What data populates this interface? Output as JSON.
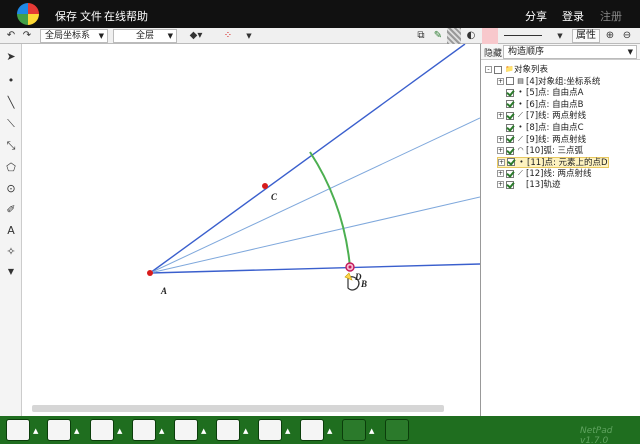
{
  "menubar": {
    "items": [
      "保存",
      "文件",
      "在线帮助"
    ],
    "right": {
      "share": "分享",
      "login": "登录",
      "register": "注册"
    }
  },
  "toolbar": {
    "coord_system": "全局坐标系",
    "layer": "全层",
    "properties": "属性"
  },
  "right_panel": {
    "hide_label": "隐藏",
    "order": "构造顺序",
    "tree": [
      {
        "label": "对象列表",
        "level": 0,
        "expander": "-",
        "check": "none",
        "icon": "folder"
      },
      {
        "label": "[4]对象组:坐标系统",
        "level": 1,
        "expander": "+",
        "check": "off",
        "icon": "group"
      },
      {
        "label": "[5]点: 自由点A",
        "level": 1,
        "expander": "",
        "check": "on",
        "icon": "point"
      },
      {
        "label": "[6]点: 自由点B",
        "level": 1,
        "expander": "",
        "check": "on",
        "icon": "point"
      },
      {
        "label": "[7]线: 两点射线",
        "level": 1,
        "expander": "+",
        "check": "on",
        "icon": "ray"
      },
      {
        "label": "[8]点: 自由点C",
        "level": 1,
        "expander": "",
        "check": "on",
        "icon": "point"
      },
      {
        "label": "[9]线: 两点射线",
        "level": 1,
        "expander": "+",
        "check": "on",
        "icon": "ray"
      },
      {
        "label": "[10]弧: 三点弧",
        "level": 1,
        "expander": "+",
        "check": "on",
        "icon": "arc"
      },
      {
        "label": "[11]点: 元素上的点D",
        "level": 1,
        "expander": "+",
        "check": "on",
        "icon": "point",
        "selected": true
      },
      {
        "label": "[12]线: 两点射线",
        "level": 1,
        "expander": "+",
        "check": "on",
        "icon": "ray"
      },
      {
        "label": "[13]轨迹",
        "level": 1,
        "expander": "+",
        "check": "on",
        "icon": "none"
      }
    ]
  },
  "canvas": {
    "points": {
      "A": "A",
      "B": "B",
      "C": "C",
      "D": "D"
    }
  },
  "bottom": {
    "version": "NetPad v1.7.0"
  },
  "colors": {
    "ray": "#3a5fcd",
    "light_ray": "#7fa8dc",
    "arc": "#4caf50",
    "point": "#d81b1b",
    "bottom_bar": "#1f6e1f"
  },
  "icons": [
    "undo-icon",
    "redo-icon",
    "tag-icon",
    "dots-icon",
    "copy-icon",
    "pen-icon",
    "fill-icon",
    "brush-icon",
    "zoom-in-icon",
    "zoom-out-icon",
    "trash-icon"
  ]
}
